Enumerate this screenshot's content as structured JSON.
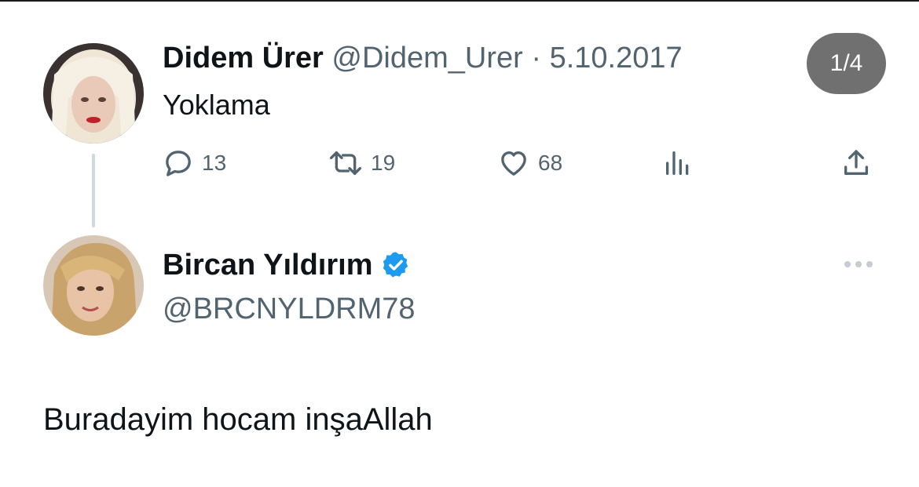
{
  "pager": {
    "counter": "1/4"
  },
  "tweet_parent": {
    "display_name": "Didem Ürer",
    "handle": "@Didem_Urer",
    "separator": "·",
    "date": "5.10.2017",
    "text": "Yoklama",
    "actions": {
      "reply_count": "13",
      "retweet_count": "19",
      "like_count": "68"
    },
    "icons": [
      "reply-icon",
      "retweet-icon",
      "like-icon",
      "views-icon",
      "share-icon"
    ]
  },
  "tweet_reply": {
    "display_name": "Bircan Yıldırım",
    "handle": "@BRCNYLDRM78",
    "verified": true,
    "text": "Buradayim hocam inşaAllah",
    "icons": [
      "verified-badge-icon",
      "more-options-icon"
    ]
  },
  "colors": {
    "text_primary": "#0f1419",
    "text_secondary": "#536471",
    "verified_blue": "#1d9bf0",
    "thread_line": "#cfd9de",
    "counter_bg": "#707070"
  }
}
